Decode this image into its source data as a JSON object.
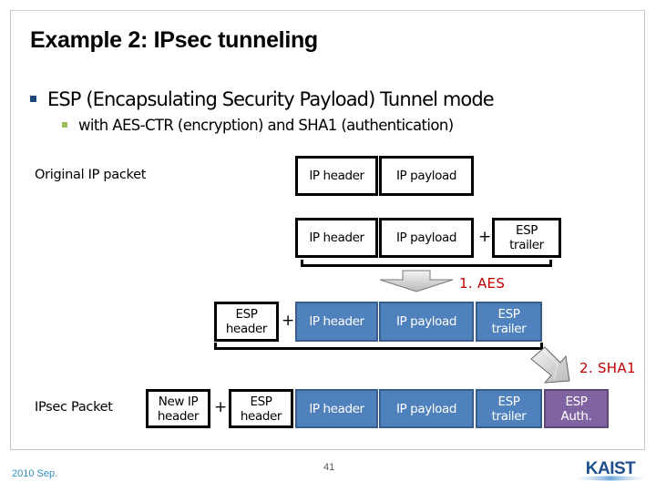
{
  "slide": {
    "title": "Example 2: IPsec tunneling",
    "bullets": [
      {
        "level": 1,
        "text": "ESP (Encapsulating Security Payload) Tunnel mode"
      },
      {
        "level": 2,
        "text": "with AES-CTR (encryption) and SHA1 (authentication)"
      }
    ],
    "colors": {
      "bullet1": "#1f497d",
      "bullet2": "#9bbb59",
      "encrypted_fill": "#4f81bd",
      "auth_fill": "#8064a2",
      "step_label": "#c00000",
      "footer_date": "#2e8fb8"
    }
  },
  "diagram": {
    "original_label": "Original IP packet",
    "ipsec_label": "IPsec Packet",
    "plus": "+",
    "row1": {
      "ip_header": "IP header",
      "ip_payload": "IP payload"
    },
    "row2": {
      "ip_header": "IP header",
      "ip_payload": "IP payload",
      "esp_trailer": "ESP trailer"
    },
    "step1": {
      "label": "1. AES",
      "icon": "arrow-down-icon"
    },
    "row3": {
      "esp_header": "ESP header",
      "ip_header": "IP header",
      "ip_payload": "IP payload",
      "esp_trailer": "ESP trailer"
    },
    "step2": {
      "label": "2. SHA1",
      "icon": "arrow-diagonal-icon"
    },
    "row4": {
      "new_ip_header": "New IP header",
      "esp_header": "ESP header",
      "ip_header": "IP header",
      "ip_payload": "IP payload",
      "esp_trailer": "ESP trailer",
      "esp_auth": "ESP Auth."
    }
  },
  "footer": {
    "date": "2010 Sep.",
    "page_number": "41",
    "logo_text": "KAIST"
  }
}
